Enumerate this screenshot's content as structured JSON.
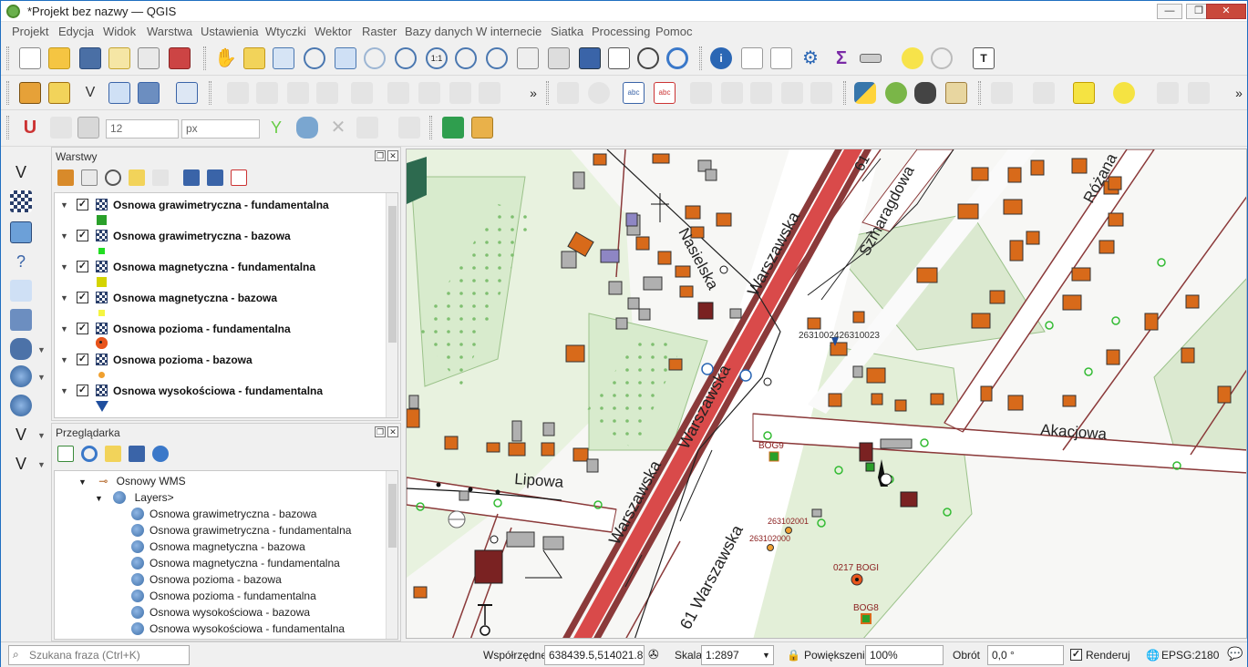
{
  "window": {
    "title": "*Projekt bez nazwy — QGIS",
    "minimize": "—",
    "restore": "❐",
    "close": "✕"
  },
  "menu": [
    "Projekt",
    "Edycja",
    "Widok",
    "Warstwa",
    "Ustawienia",
    "Wtyczki",
    "Wektor",
    "Raster",
    "Bazy danych",
    "W internecie",
    "Siatka",
    "Processing",
    "Pomoc"
  ],
  "snapping": {
    "tolerance": "12",
    "units": "px"
  },
  "layers_panel": {
    "title": "Warstwy",
    "layers": [
      {
        "label": "Osnowa grawimetryczna - fundamentalna",
        "checked": "✓",
        "expand": "▼",
        "symbol": "square",
        "color": "#2aa02a"
      },
      {
        "label": "Osnowa grawimetryczna - bazowa",
        "checked": "✓",
        "expand": "▼",
        "symbol": "square-small",
        "color": "#22dd22"
      },
      {
        "label": "Osnowa magnetyczna - fundamentalna",
        "checked": "✓",
        "expand": "▼",
        "symbol": "square",
        "color": "#d4d400"
      },
      {
        "label": "Osnowa magnetyczna - bazowa",
        "checked": "✓",
        "expand": "▼",
        "symbol": "square-small",
        "color": "#f5f542"
      },
      {
        "label": "Osnowa pozioma - fundamentalna",
        "checked": "✓",
        "expand": "▼",
        "symbol": "circle",
        "color": "#e8541c"
      },
      {
        "label": "Osnowa pozioma - bazowa",
        "checked": "✓",
        "expand": "▼",
        "symbol": "circle-small",
        "color": "#f0a030"
      },
      {
        "label": "Osnowa wysokościowa - fundamentalna",
        "checked": "✓",
        "expand": "▼",
        "symbol": "triangle",
        "color": "#1f4e9e"
      }
    ]
  },
  "browser_panel": {
    "title": "Przeglądarka",
    "wms_root": "Osnowy WMS",
    "layers_group": "Layers>",
    "items": [
      "Osnowa grawimetryczna - bazowa",
      "Osnowa grawimetryczna - fundamentalna",
      "Osnowa magnetyczna - bazowa",
      "Osnowa magnetyczna - fundamentalna",
      "Osnowa pozioma - bazowa",
      "Osnowa pozioma - fundamentalna",
      "Osnowa wysokościowa - bazowa",
      "Osnowa wysokościowa - fundamentalna"
    ]
  },
  "map": {
    "streets": [
      "Warszawska",
      "Warszawska",
      "Warszawska",
      "61 Warszawska",
      "61",
      "Nasielska",
      "Szmaragdowa",
      "Różana",
      "Akacjowa",
      "Lipowa"
    ],
    "points": [
      "2631002426310023",
      "BOG9",
      "263102001",
      "263102000",
      "0217 BOGI",
      "BOG8"
    ]
  },
  "status": {
    "search_placeholder": "Szukana fraza (Ctrl+K)",
    "coords_label": "Współrzędne",
    "coords_value": "638439.5,514021.8",
    "scale_label": "Skala",
    "scale_value": "1:2897",
    "zoom_label": "Powiększenie",
    "zoom_value": "100%",
    "rotation_label": "Obrót",
    "rotation_value": "0,0 °",
    "render_label": "Renderuj",
    "render_checked": "✓",
    "crs": "EPSG:2180"
  }
}
